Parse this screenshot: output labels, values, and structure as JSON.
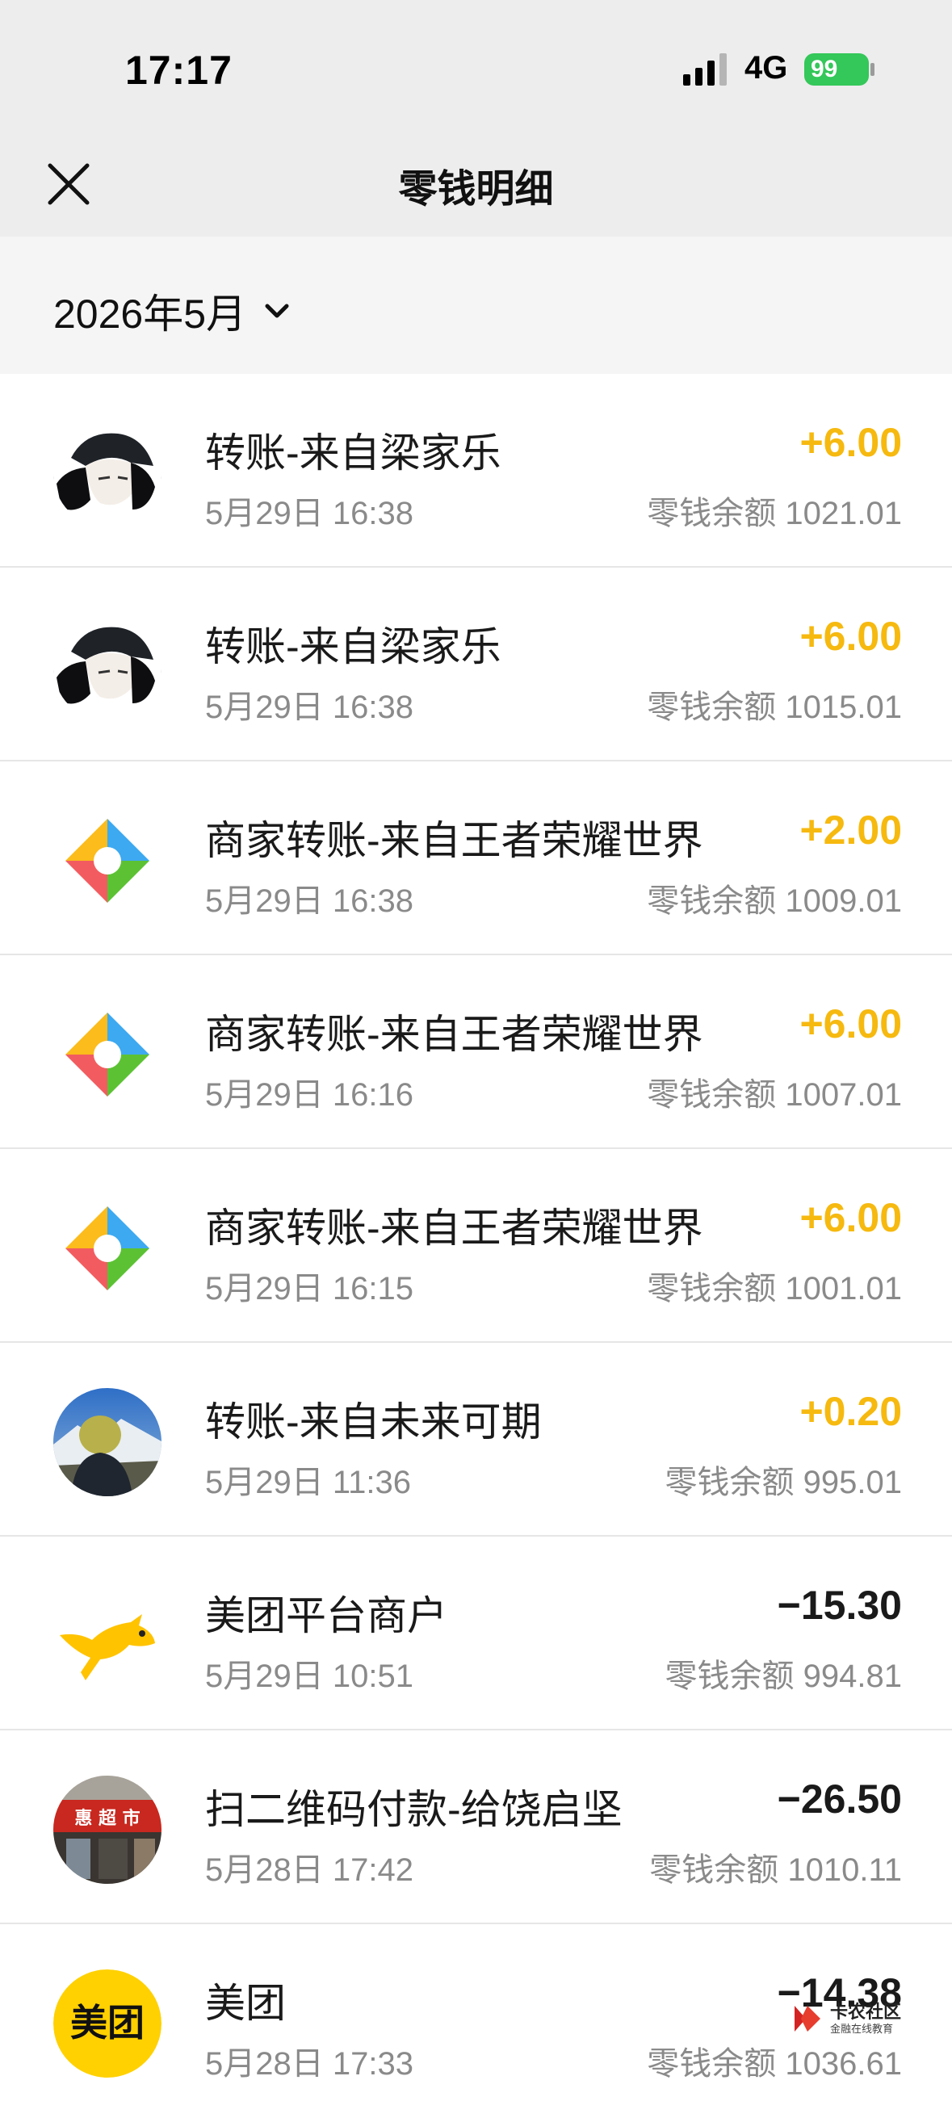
{
  "status_bar": {
    "time": "17:17",
    "network": "4G",
    "battery": "99"
  },
  "nav": {
    "title": "零钱明细"
  },
  "filter": {
    "month": "2026年5月"
  },
  "transactions": [
    {
      "title": "转账-来自梁家乐",
      "datetime": "5月29日 16:38",
      "amount": "+6.00",
      "balance": "零钱余额 1021.01",
      "type": "income",
      "avatar": "anime-person-avatar"
    },
    {
      "title": "转账-来自梁家乐",
      "datetime": "5月29日 16:38",
      "amount": "+6.00",
      "balance": "零钱余额 1015.01",
      "type": "income",
      "avatar": "anime-person-avatar"
    },
    {
      "title": "商家转账-来自王者荣耀世界",
      "datetime": "5月29日 16:38",
      "amount": "+2.00",
      "balance": "零钱余额 1009.01",
      "type": "income",
      "avatar": "merchant-logo"
    },
    {
      "title": "商家转账-来自王者荣耀世界",
      "datetime": "5月29日 16:16",
      "amount": "+6.00",
      "balance": "零钱余额 1007.01",
      "type": "income",
      "avatar": "merchant-logo"
    },
    {
      "title": "商家转账-来自王者荣耀世界",
      "datetime": "5月29日 16:15",
      "amount": "+6.00",
      "balance": "零钱余额 1001.01",
      "type": "income",
      "avatar": "merchant-logo"
    },
    {
      "title": "转账-来自未来可期",
      "datetime": "5月29日 11:36",
      "amount": "+0.20",
      "balance": "零钱余额 995.01",
      "type": "income",
      "avatar": "photo-avatar"
    },
    {
      "title": "美团平台商户",
      "datetime": "5月29日 10:51",
      "amount": "−15.30",
      "balance": "零钱余额 994.81",
      "type": "expense",
      "avatar": "meituan-kangaroo-logo"
    },
    {
      "title": "扫二维码付款-给饶启坚",
      "datetime": "5月28日 17:42",
      "amount": "−26.50",
      "balance": "零钱余额 1010.11",
      "type": "expense",
      "avatar": "storefront-photo-avatar"
    },
    {
      "title": "美团",
      "datetime": "5月28日 17:33",
      "amount": "−14.38",
      "balance": "零钱余额 1036.61",
      "type": "expense",
      "avatar": "meituan-logo"
    }
  ],
  "avatar_text": {
    "storefront_sign": "惠 超 市",
    "meituan": "美团"
  },
  "watermark": {
    "text": "卡农社区",
    "sub": "金融在线教育"
  },
  "colors": {
    "income": "#f6b90f",
    "expense": "#1a1a1a",
    "battery": "#34c759",
    "header_bg": "#ededed",
    "meituan_yellow": "#ffd100"
  }
}
